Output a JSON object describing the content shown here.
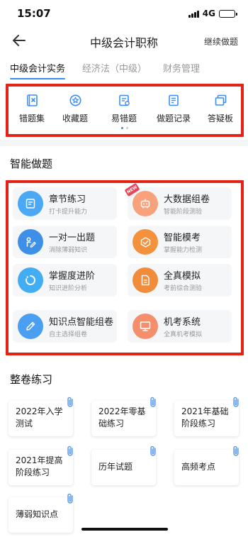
{
  "status": {
    "time": "15:07",
    "network": "4G",
    "battery_level": 0.35
  },
  "nav": {
    "title": "中级会计职称",
    "right_action": "继续做题"
  },
  "subject_tabs": [
    {
      "label": "中级会计实务",
      "active": true
    },
    {
      "label": "经济法（中级）",
      "active": false
    },
    {
      "label": "财务管理",
      "active": false
    }
  ],
  "tools": [
    {
      "label": "错题集",
      "icon": "mistake-book-icon"
    },
    {
      "label": "收藏题",
      "icon": "star-icon"
    },
    {
      "label": "易错题",
      "icon": "error-prone-icon"
    },
    {
      "label": "做题记录",
      "icon": "record-icon"
    },
    {
      "label": "答疑板",
      "icon": "qa-board-icon"
    }
  ],
  "tools_pager": {
    "pages": 2,
    "current": 1
  },
  "smart_section": {
    "title": "智能做题"
  },
  "smart_cards": [
    {
      "title": "章节练习",
      "subtitle": "打卡提升能力",
      "icon": "chapter-icon",
      "color": "#4aa8f5"
    },
    {
      "title": "大数据组卷",
      "subtitle": "智能阶段测验",
      "icon": "robot-icon",
      "color": "#f7a27d",
      "badge": "NEW"
    },
    {
      "title": "一对一出题",
      "subtitle": "消除薄弱知识",
      "icon": "pen-person-icon",
      "color": "#3d8fe8"
    },
    {
      "title": "智能模考",
      "subtitle": "掌握能力检测",
      "icon": "smart-exam-icon",
      "color": "#f3913d"
    },
    {
      "title": "掌握度进阶",
      "subtitle": "知识进阶分析",
      "icon": "progress-ring-icon",
      "color": "#42adf2"
    },
    {
      "title": "全真模拟",
      "subtitle": "考前综合测验",
      "icon": "document-icon",
      "color": "#f08c3a"
    },
    {
      "title": "知识点智能组卷",
      "subtitle": "自主选择组卷",
      "icon": "pencil-icon",
      "color": "#4b9ff0"
    },
    {
      "title": "机考系统",
      "subtitle": "全真机考模拟",
      "icon": "monitor-icon",
      "color": "#f58f6b"
    }
  ],
  "paper_section": {
    "title": "整卷练习"
  },
  "papers": [
    {
      "title": "2022年入学测试"
    },
    {
      "title": "2022年零基础练习"
    },
    {
      "title": "2021年基础阶段练习"
    },
    {
      "title": "2021年提高阶段练习"
    },
    {
      "title": "历年试题"
    },
    {
      "title": "高频考点"
    },
    {
      "title": "薄弱知识点"
    }
  ],
  "colors": {
    "accent": "#3b8df5",
    "highlight_box": "#e02418"
  }
}
